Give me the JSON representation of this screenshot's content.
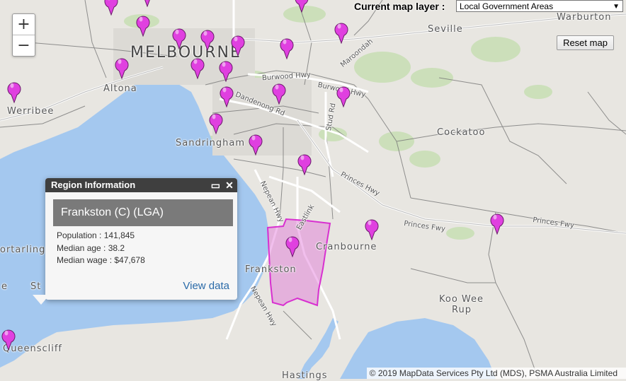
{
  "map": {
    "layer_label": "Current map layer :",
    "layer_selected": "Local Government Areas",
    "reset_label": "Reset map",
    "zoom_in": "+",
    "zoom_out": "−",
    "attribution": "© 2019 MapData Services Pty Ltd (MDS), PSMA Australia Limited",
    "pin_color": "#e040e0",
    "region_color": "#e070d8",
    "water_color": "#a4c8ef"
  },
  "places": {
    "melbourne": "MELBOURNE",
    "altona": "Altona",
    "werribee": "Werribee",
    "sandringham": "Sandringham",
    "frankston": "Frankston",
    "cranbourne": "Cranbourne",
    "cockatoo": "Cockatoo",
    "seville": "Seville",
    "warburton": "Warburton",
    "koo_wee_rup": "Koo Wee",
    "koo_wee_rup_2": "Rup",
    "queenscliff": "Queenscliff",
    "portarlington": "ortarling",
    "hastings": "Hastings",
    "st": "St",
    "e": "e"
  },
  "roads": {
    "burwood": "Burwood Hwy",
    "burwood2": "Burwood Hwy",
    "dandenong": "Dandenong Rd",
    "princes1": "Princes Hwy",
    "princes2": "Princes Fwy",
    "princes3": "Princes Fwy",
    "stud": "Stud Rd",
    "maroondah": "Maroondah",
    "nepean": "Nepean Hwy",
    "nepean2": "Nepean Hwy",
    "eastlink": "Eastlink"
  },
  "popup": {
    "header": "Region Information",
    "title": "Frankston (C) (LGA)",
    "population": "Population : 141,845",
    "median_age": "Median age : 38.2",
    "median_wage": "Median wage : $47,678",
    "view_data": "View data",
    "minimize_icon": "window-minimize-icon",
    "close_icon": "close-icon"
  }
}
